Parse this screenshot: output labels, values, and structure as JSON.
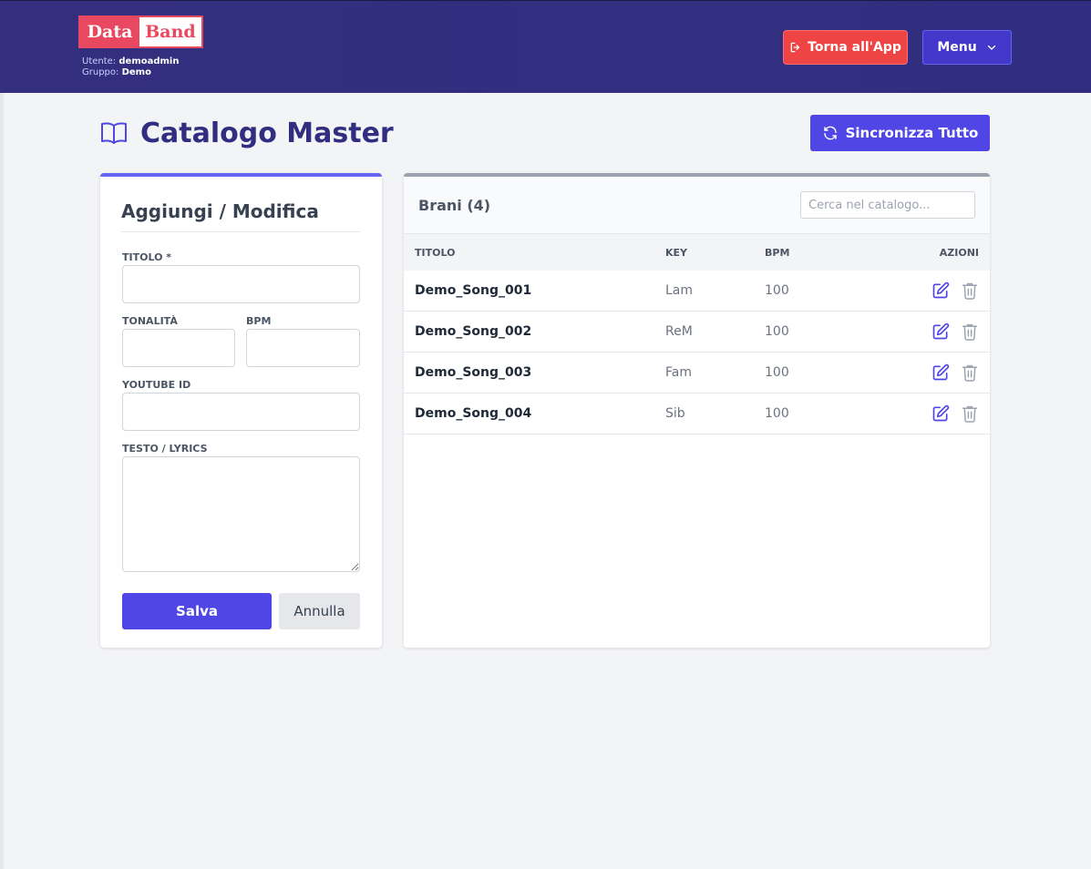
{
  "header": {
    "logo_left": "Data",
    "logo_right": "Band",
    "user_label": "Utente:",
    "user_name": "demoadmin",
    "group_label": "Gruppo:",
    "group_name": "Demo",
    "back_button": "Torna all'App",
    "menu_button": "Menu"
  },
  "page": {
    "title": "Catalogo Master",
    "sync_button": "Sincronizza Tutto"
  },
  "form": {
    "title": "Aggiungi / Modifica",
    "title_label": "TITOLO *",
    "key_label": "TONALITÀ",
    "bpm_label": "BPM",
    "youtube_label": "YOUTUBE ID",
    "lyrics_label": "TESTO / LYRICS",
    "save_button": "Salva",
    "cancel_button": "Annulla"
  },
  "list": {
    "title": "Brani (4)",
    "search_placeholder": "Cerca nel catalogo...",
    "columns": [
      "TITOLO",
      "KEY",
      "BPM",
      "AZIONI"
    ],
    "rows": [
      {
        "title": "Demo_Song_001",
        "key": "Lam",
        "bpm": "100"
      },
      {
        "title": "Demo_Song_002",
        "key": "ReM",
        "bpm": "100"
      },
      {
        "title": "Demo_Song_003",
        "key": "Fam",
        "bpm": "100"
      },
      {
        "title": "Demo_Song_004",
        "key": "Sib",
        "bpm": "100"
      }
    ]
  },
  "colors": {
    "navbar": "#312e81",
    "primary": "#4f46e5",
    "danger": "#ef4444",
    "logo": "#e84860"
  },
  "icons": [
    "logout-icon",
    "chevron-down-icon",
    "book-icon",
    "sync-icon",
    "edit-icon",
    "trash-icon"
  ]
}
